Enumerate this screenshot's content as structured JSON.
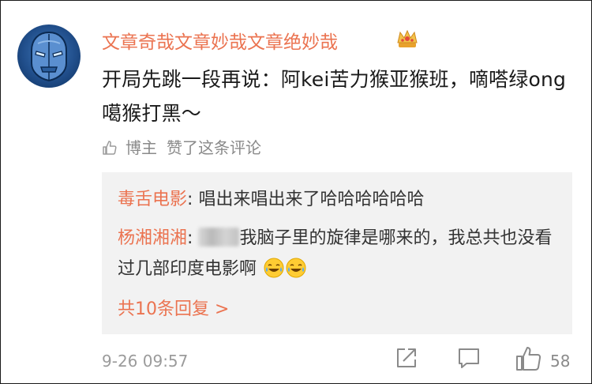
{
  "comment": {
    "username": "文章奇哉文章妙哉文章绝妙哉",
    "badge_icon": "crown-icon",
    "text": "开局先跳一段再说：阿kei苦力猴亚猴班，嘀嗒绿ong噶猴打黑～",
    "author_liked": {
      "author": "博主",
      "action": "赞了这条评论"
    },
    "timestamp": "9-26 09:57",
    "like_count": "58"
  },
  "replies": {
    "items": [
      {
        "name": "毒舌电影",
        "sep": ":",
        "text": "唱出来唱出来了哈哈哈哈哈哈"
      },
      {
        "name": "杨湘湘湘",
        "sep": ":",
        "text": "我脑子里的旋律是哪来的，我总共也没看过几部印度电影啊"
      }
    ],
    "more_label": "共10条回复 >"
  },
  "colors": {
    "accent": "#eb7350",
    "text": "#1a1a1a",
    "muted": "#8a8a8a",
    "reply_bg": "#f2f2f2"
  }
}
